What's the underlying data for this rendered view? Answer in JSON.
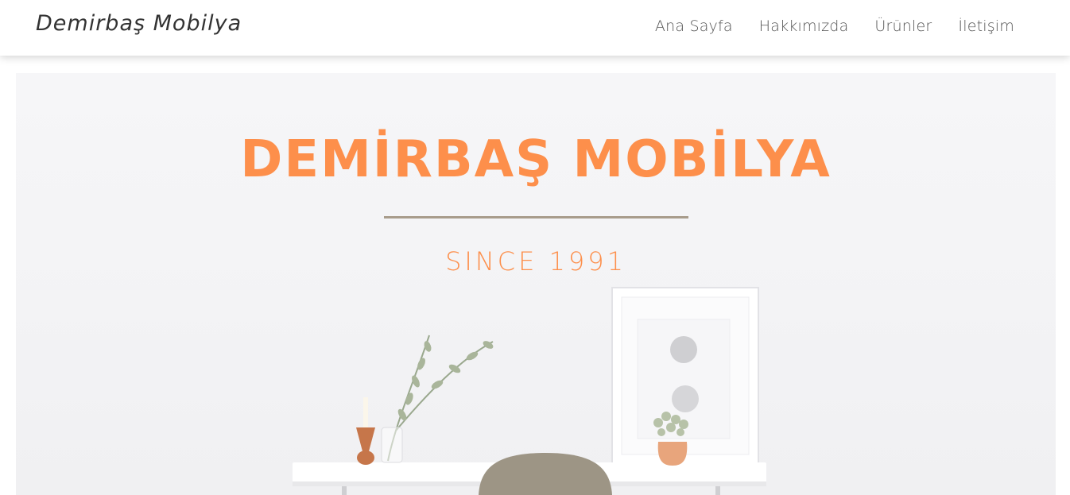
{
  "navbar": {
    "brand": "Demirbaş Mobilya",
    "links": [
      "Ana Sayfa",
      "Hakkımızda",
      "Ürünler",
      "İletişim"
    ]
  },
  "hero": {
    "title": "DEMİRBAŞ MOBİLYA",
    "subtitle": "SINCE 1991"
  },
  "colors": {
    "accent": "#fd8f4b",
    "divider": "#a89c8b",
    "nav_text": "#555555"
  }
}
